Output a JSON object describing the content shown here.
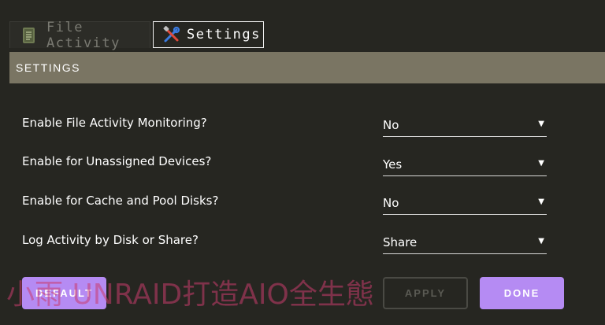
{
  "tabs": [
    {
      "label": "File Activity",
      "icon": "notebook-icon",
      "active": false
    },
    {
      "label": "Settings",
      "icon": "tools-icon",
      "active": true
    }
  ],
  "section": {
    "title": "SETTINGS"
  },
  "settings": [
    {
      "label": "Enable File Activity Monitoring?",
      "value": "No"
    },
    {
      "label": "Enable for Unassigned Devices?",
      "value": "Yes"
    },
    {
      "label": "Enable for Cache and Pool Disks?",
      "value": "No"
    },
    {
      "label": "Log Activity by Disk or Share?",
      "value": "Share"
    }
  ],
  "buttons": {
    "default": "DEFAULT",
    "apply": "APPLY",
    "done": "DONE"
  },
  "watermark": "小雨 UNRAID打造AIO全生態",
  "colors": {
    "background": "#262621",
    "header": "#7a7563",
    "accent": "#b58bf3",
    "watermark": "#c83c6e"
  }
}
